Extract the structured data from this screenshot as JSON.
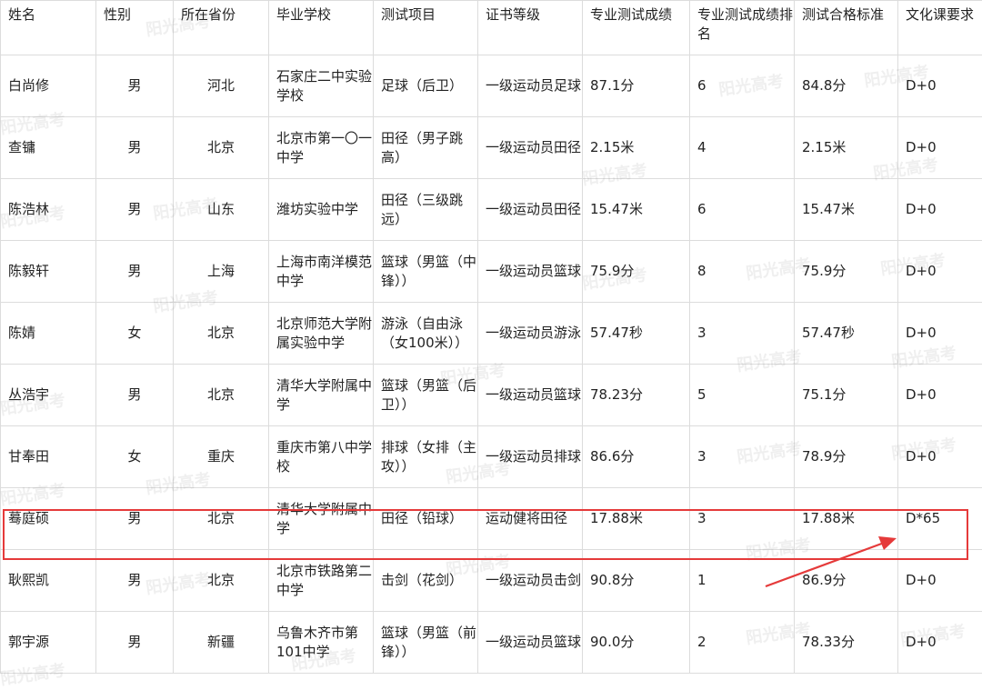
{
  "headers": [
    "姓名",
    "性别",
    "所在省份",
    "毕业学校",
    "测试项目",
    "证书等级",
    "专业测试成绩",
    "专业测试成绩排名",
    "测试合格标准",
    "文化课要求"
  ],
  "rows": [
    {
      "name": "白尚修",
      "gender": "男",
      "province": "河北",
      "school": "石家庄二中实验学校",
      "event": "足球（后卫）",
      "cert": "一级运动员足球",
      "score": "87.1分",
      "rank": "6",
      "standard": "84.8分",
      "req": "D+0"
    },
    {
      "name": "查镛",
      "gender": "男",
      "province": "北京",
      "school": "北京市第一〇一中学",
      "event": "田径（男子跳高）",
      "cert": "一级运动员田径",
      "score": "2.15米",
      "rank": "4",
      "standard": "2.15米",
      "req": "D+0"
    },
    {
      "name": "陈浩林",
      "gender": "男",
      "province": "山东",
      "school": "潍坊实验中学",
      "event": "田径（三级跳远）",
      "cert": "一级运动员田径",
      "score": "15.47米",
      "rank": "6",
      "standard": "15.47米",
      "req": "D+0"
    },
    {
      "name": "陈毅轩",
      "gender": "男",
      "province": "上海",
      "school": "上海市南洋模范中学",
      "event": "篮球（男篮（中锋））",
      "cert": "一级运动员篮球",
      "score": "75.9分",
      "rank": "8",
      "standard": "75.9分",
      "req": "D+0"
    },
    {
      "name": "陈婧",
      "gender": "女",
      "province": "北京",
      "school": "北京师范大学附属实验中学",
      "event": "游泳（自由泳（女100米））",
      "cert": "一级运动员游泳",
      "score": "57.47秒",
      "rank": "3",
      "standard": "57.47秒",
      "req": "D+0"
    },
    {
      "name": "丛浩宇",
      "gender": "男",
      "province": "北京",
      "school": "清华大学附属中学",
      "event": "篮球（男篮（后卫））",
      "cert": "一级运动员篮球",
      "score": "78.23分",
      "rank": "5",
      "standard": "75.1分",
      "req": "D+0"
    },
    {
      "name": "甘奉田",
      "gender": "女",
      "province": "重庆",
      "school": "重庆市第八中学校",
      "event": "排球（女排（主攻））",
      "cert": "一级运动员排球",
      "score": "86.6分",
      "rank": "3",
      "standard": "78.9分",
      "req": "D+0"
    },
    {
      "name": "蓦庭硕",
      "gender": "男",
      "province": "北京",
      "school": "清华大学附属中学",
      "event": "田径（铅球）",
      "cert": "运动健将田径",
      "score": "17.88米",
      "rank": "3",
      "standard": "17.88米",
      "req": "D*65"
    },
    {
      "name": "耿熙凯",
      "gender": "男",
      "province": "北京",
      "school": "北京市铁路第二中学",
      "event": "击剑（花剑）",
      "cert": "一级运动员击剑",
      "score": "90.8分",
      "rank": "1",
      "standard": "86.9分",
      "req": "D+0"
    },
    {
      "name": "郭宇源",
      "gender": "男",
      "province": "新疆",
      "school": "乌鲁木齐市第101中学",
      "event": "篮球（男篮（前锋））",
      "cert": "一级运动员篮球",
      "score": "90.0分",
      "rank": "2",
      "standard": "78.33分",
      "req": "D+0"
    }
  ],
  "watermark": "阳光高考",
  "highlight_color": "#e53a3a"
}
